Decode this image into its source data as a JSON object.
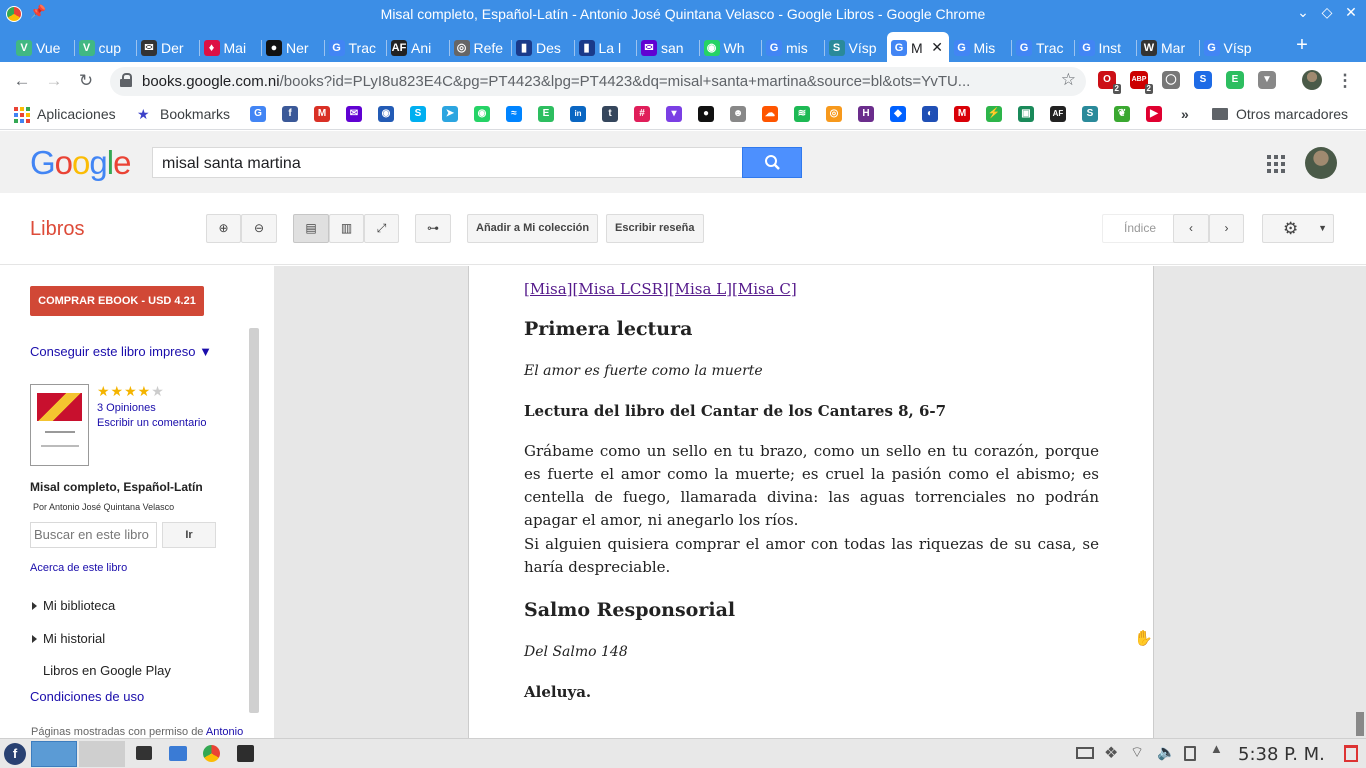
{
  "window": {
    "title": "Misal completo, Español-Latín - Antonio José Quintana Velasco - Google Libros - Google Chrome"
  },
  "tabs": [
    {
      "label": "Vue",
      "icon": "vue-icon",
      "color": "#41b883",
      "glyph": "V"
    },
    {
      "label": "cup",
      "icon": "vue-icon",
      "color": "#41b883",
      "glyph": "V"
    },
    {
      "label": "Der",
      "icon": "mail-icon",
      "color": "#333",
      "glyph": "✉"
    },
    {
      "label": "Mai",
      "icon": "gift-icon",
      "color": "#d14",
      "glyph": "♦"
    },
    {
      "label": "Ner",
      "icon": "github-icon",
      "color": "#111",
      "glyph": "●"
    },
    {
      "label": "Trac",
      "icon": "translate-icon",
      "color": "#4285f4",
      "glyph": "G"
    },
    {
      "label": "Ani",
      "icon": "af-icon",
      "color": "#222",
      "glyph": "AF"
    },
    {
      "label": "Refe",
      "icon": "ref-icon",
      "color": "#666",
      "glyph": "◎"
    },
    {
      "label": "Des",
      "icon": "book-icon",
      "color": "#1a3a8a",
      "glyph": "▮"
    },
    {
      "label": "La l",
      "icon": "book-icon",
      "color": "#1a3a8a",
      "glyph": "▮"
    },
    {
      "label": "san",
      "icon": "yahoo-icon",
      "color": "#6001d2",
      "glyph": "✉"
    },
    {
      "label": "Wh",
      "icon": "whatsapp-icon",
      "color": "#25d366",
      "glyph": "◉"
    },
    {
      "label": "mis",
      "icon": "google-icon",
      "color": "#4285f4",
      "glyph": "G"
    },
    {
      "label": "Vísp",
      "icon": "sync-icon",
      "color": "#2a8a9a",
      "glyph": "S"
    },
    {
      "label": "M",
      "icon": "google-icon",
      "color": "#4285f4",
      "glyph": "G"
    },
    {
      "label": "Mis",
      "icon": "google-icon",
      "color": "#4285f4",
      "glyph": "G"
    },
    {
      "label": "Trac",
      "icon": "google-icon",
      "color": "#4285f4",
      "glyph": "G"
    },
    {
      "label": "Inst",
      "icon": "google-icon",
      "color": "#4285f4",
      "glyph": "G"
    },
    {
      "label": "Mar",
      "icon": "wikipedia-icon",
      "color": "#333",
      "glyph": "W"
    },
    {
      "label": "Vísp",
      "icon": "google-icon",
      "color": "#4285f4",
      "glyph": "G"
    }
  ],
  "active_tab": 14,
  "address": {
    "host": "books.google.com.ni",
    "path": "/books?id=PLyI8u823E4C&pg=PT4423&lpg=PT4423&dq=misal+santa+martina&source=bl&ots=YvTU..."
  },
  "extensions": [
    {
      "icon": "opera-ext-icon",
      "color": "#cc0f16",
      "glyph": "O",
      "badge": "2"
    },
    {
      "icon": "abp-ext-icon",
      "color": "#c00",
      "glyph": "ABP",
      "badge": "2"
    },
    {
      "icon": "circle-ext-icon",
      "color": "#777",
      "glyph": "◯",
      "badge": ""
    },
    {
      "icon": "s-ext-icon",
      "color": "#1e6be6",
      "glyph": "S",
      "badge": ""
    },
    {
      "icon": "evernote-ext-icon",
      "color": "#2dbe60",
      "glyph": "E",
      "badge": ""
    },
    {
      "icon": "vivaldi-ext-icon",
      "color": "#888",
      "glyph": "▼",
      "badge": ""
    }
  ],
  "bookmarks": {
    "apps_label": "Aplicaciones",
    "bookmarks_label": "Bookmarks",
    "more_label": "»",
    "other_label": "Otros marcadores",
    "icons": [
      {
        "name": "google-bm-icon",
        "color": "#4285f4",
        "glyph": "G"
      },
      {
        "name": "facebook-bm-icon",
        "color": "#3b5998",
        "glyph": "f"
      },
      {
        "name": "gmail-bm-icon",
        "color": "#d93025",
        "glyph": "M"
      },
      {
        "name": "yahoo-mail-bm-icon",
        "color": "#6001d2",
        "glyph": "✉"
      },
      {
        "name": "thunderbird-bm-icon",
        "color": "#235bb5",
        "glyph": "◉"
      },
      {
        "name": "skype-bm-icon",
        "color": "#00aff0",
        "glyph": "S"
      },
      {
        "name": "telegram-bm-icon",
        "color": "#2ca5e0",
        "glyph": "➤"
      },
      {
        "name": "whatsapp-bm-icon",
        "color": "#25d366",
        "glyph": "◉"
      },
      {
        "name": "messenger-bm-icon",
        "color": "#0084ff",
        "glyph": "≈"
      },
      {
        "name": "evernote-bm-icon",
        "color": "#2dbe60",
        "glyph": "E"
      },
      {
        "name": "linkedin-bm-icon",
        "color": "#0a66c2",
        "glyph": "in"
      },
      {
        "name": "tumblr-bm-icon",
        "color": "#35465c",
        "glyph": "t"
      },
      {
        "name": "slack-bm-icon",
        "color": "#e01e5a",
        "glyph": "#"
      },
      {
        "name": "pocket-bm-icon",
        "color": "#7b3fe4",
        "glyph": "▾"
      },
      {
        "name": "github-bm-icon",
        "color": "#111",
        "glyph": "●"
      },
      {
        "name": "cat-bm-icon",
        "color": "#888",
        "glyph": "☻"
      },
      {
        "name": "soundcloud-bm-icon",
        "color": "#ff5500",
        "glyph": "☁"
      },
      {
        "name": "spotify-bm-icon",
        "color": "#1db954",
        "glyph": "≋"
      },
      {
        "name": "audible-bm-icon",
        "color": "#f7991c",
        "glyph": "◎"
      },
      {
        "name": "h-bm-icon",
        "color": "#6b2d8c",
        "glyph": "H"
      },
      {
        "name": "dropbox-bm-icon",
        "color": "#0061ff",
        "glyph": "◆"
      },
      {
        "name": "browser-bm-icon",
        "color": "#1f4fb5",
        "glyph": "◐"
      },
      {
        "name": "mega-bm-icon",
        "color": "#d90007",
        "glyph": "M"
      },
      {
        "name": "bolt-bm-icon",
        "color": "#2db54a",
        "glyph": "⚡"
      },
      {
        "name": "gamepad-bm-icon",
        "color": "#1a8a5a",
        "glyph": "▣"
      },
      {
        "name": "af-bm-icon",
        "color": "#222",
        "glyph": "AF"
      },
      {
        "name": "sync-bm-icon",
        "color": "#2a8a9a",
        "glyph": "S"
      },
      {
        "name": "leaf-bm-icon",
        "color": "#3aa830",
        "glyph": "❦"
      },
      {
        "name": "play-bm-icon",
        "color": "#e00030",
        "glyph": "▶"
      }
    ]
  },
  "google": {
    "query": "misal santa martina"
  },
  "books_toolbar": {
    "title": "Libros",
    "add_collection": "Añadir a Mi colección",
    "write_review": "Escribir reseña",
    "index": "Índice"
  },
  "sidebar": {
    "buy": "COMPRAR EBOOK - USD 4.21",
    "get_print": "Conseguir este libro impreso ▼",
    "rating": 3.5,
    "opinions": "3 Opiniones",
    "write_comment": "Escribir un comentario",
    "book_title": "Misal completo, Español-Latín",
    "author": "Por Antonio José Quintana Velasco",
    "search_placeholder": "Buscar en este libro",
    "go": "Ir",
    "about": "Acerca de este libro",
    "my_library": "Mi biblioteca",
    "my_history": "Mi historial",
    "play_books": "Libros en Google Play",
    "terms": "Condiciones de uso",
    "pages_shown": "Páginas mostradas con permiso de",
    "pages_shown_link": "Antonio"
  },
  "page": {
    "links": "[Misa][Misa LCSR][Misa L][Misa C]",
    "heading1": "Primera lectura",
    "subtitle1": "El amor es fuerte como la muerte",
    "reading_title": "Lectura del libro del Cantar de los Cantares 8, 6-7",
    "paragraph1": "Grábame como un sello en tu brazo, como un sello en tu corazón, porque es fuerte el amor como la muerte; es cruel la pasión como el abismo; es centella de fuego, llamarada divina: las aguas torrenciales no podrán apagar el amor, ni anegarlo los ríos.",
    "paragraph2": "Si alguien quisiera comprar el amor con todas las riquezas de su casa, se haría despreciable.",
    "heading2": "Salmo Responsorial",
    "subtitle2": "Del Salmo 148",
    "aleluya": "Aleluya."
  },
  "taskbar": {
    "clock": "5:38 P. M."
  }
}
